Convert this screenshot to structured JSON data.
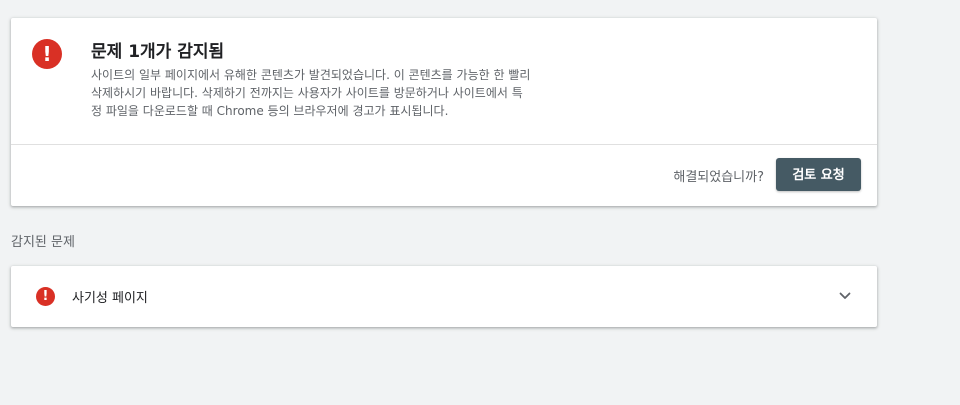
{
  "alert": {
    "icon": "exclamation-icon",
    "title": "문제 1개가 감지됨",
    "description_lines": [
      "사이트의 일부 페이지에서 유해한 콘텐츠가 발견되었습니다. 이 콘텐츠를 가능한 한 빨리",
      "삭제하시기 바랍니다. 삭제하기 전까지는 사용자가 사이트를 방문하거나 사이트에서 특",
      "정 파일을 다운로드할 때 Chrome 등의 브라우저에 경고가 표시됩니다."
    ],
    "resolved_question": "해결되었습니까?",
    "review_button": "검토 요청"
  },
  "detected": {
    "heading": "감지된 문제",
    "issues": [
      {
        "icon": "exclamation-icon",
        "label": "사기성 페이지",
        "expand_icon": "chevron-down-icon"
      }
    ]
  },
  "colors": {
    "background": "#f1f3f4",
    "error_red": "#d93025",
    "button_bg": "#455a64"
  }
}
